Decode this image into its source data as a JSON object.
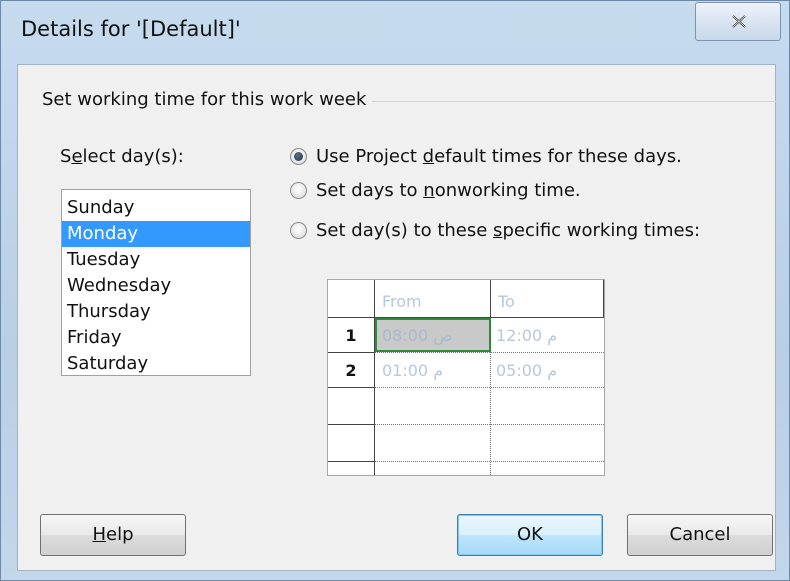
{
  "window": {
    "title": "Details for '[Default]'",
    "close_icon": "close-icon"
  },
  "group": {
    "label": "Set working time for this work week"
  },
  "days": {
    "label_pre": "S",
    "label_u": "e",
    "label_post": "lect day(s):",
    "items": [
      {
        "label": "Sunday",
        "selected": false
      },
      {
        "label": "Monday",
        "selected": true
      },
      {
        "label": "Tuesday",
        "selected": false
      },
      {
        "label": "Wednesday",
        "selected": false
      },
      {
        "label": "Thursday",
        "selected": false
      },
      {
        "label": "Friday",
        "selected": false
      },
      {
        "label": "Saturday",
        "selected": false
      }
    ]
  },
  "options": [
    {
      "pre": "Use Project ",
      "u": "d",
      "post": "efault times for these days.",
      "checked": true
    },
    {
      "pre": "Set days to ",
      "u": "n",
      "post": "onworking time.",
      "checked": false
    },
    {
      "pre": "Set day(s) to these ",
      "u": "s",
      "post": "pecific working times:",
      "checked": false
    }
  ],
  "times": {
    "headers": {
      "from": "From",
      "to": "To"
    },
    "rows": [
      {
        "num": "1",
        "from": "08:00 ص",
        "to": "12:00 م"
      },
      {
        "num": "2",
        "from": "01:00 م",
        "to": "05:00 م"
      }
    ]
  },
  "buttons": {
    "help_u": "H",
    "help_post": "elp",
    "ok": "OK",
    "cancel": "Cancel"
  },
  "colors": {
    "selection": "#3399ff",
    "active_cell_border": "#2f8a3a",
    "disabled_text": "#b7c8dd"
  }
}
